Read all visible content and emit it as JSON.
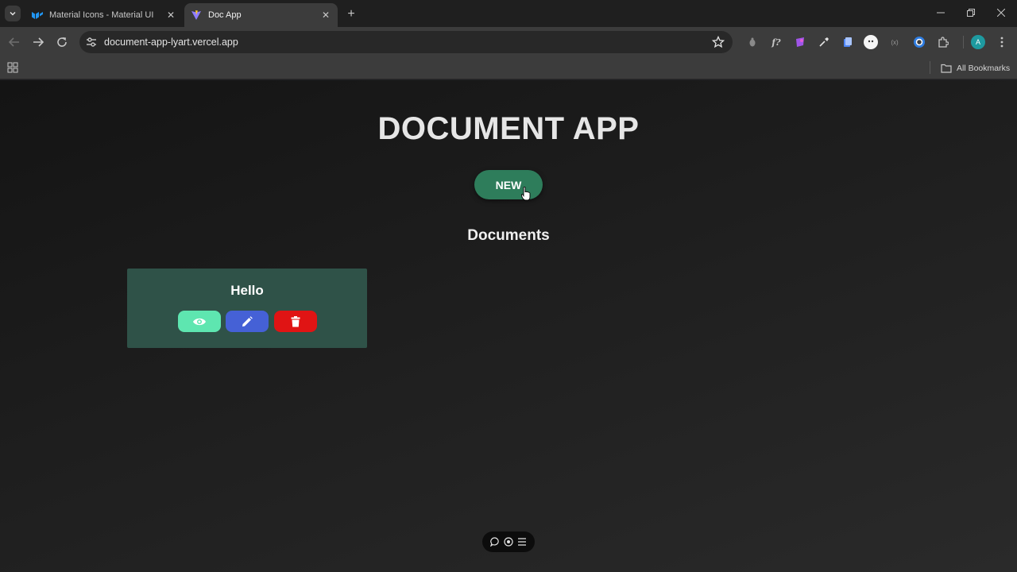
{
  "browser": {
    "tabs": [
      {
        "title": "Material Icons - Material UI",
        "active": false,
        "favicon": "mui-logo-icon"
      },
      {
        "title": "Doc App",
        "active": true,
        "favicon": "vite-logo-icon"
      }
    ],
    "url": "document-app-lyart.vercel.app",
    "profile_initial": "A",
    "bookmarks_label": "All Bookmarks",
    "extension_ff_label": "f?",
    "extension_misc_label": "(x)"
  },
  "app": {
    "title": "DOCUMENT APP",
    "new_button_label": "NEW",
    "documents_heading": "Documents",
    "documents": [
      {
        "title": "Hello"
      }
    ]
  },
  "colors": {
    "new_button": "#2e7d5b",
    "card_background": "#2f5248",
    "view_button": "#5ee6b0",
    "edit_button": "#4561d6",
    "delete_button": "#e01414"
  }
}
